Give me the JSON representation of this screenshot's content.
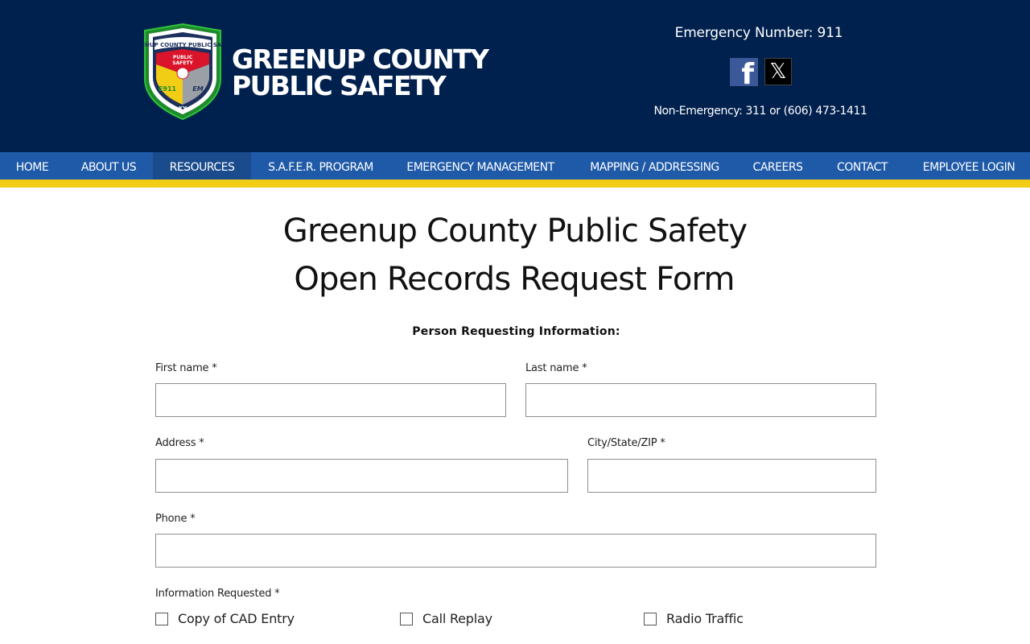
{
  "header": {
    "logo_text": "GREENUP COUNTY PUBLIC SAFETY",
    "logo_sub": "KY",
    "brand_line1": "GREENUP COUNTY",
    "brand_line2": "PUBLIC SAFETY",
    "emergency": "Emergency Number: 911",
    "non_emergency": "Non-Emergency: 311 or (606) 473-1411",
    "social": [
      {
        "name": "facebook-icon",
        "glyph": "f"
      },
      {
        "name": "x-twitter-icon",
        "glyph": "𝕏"
      }
    ]
  },
  "nav": {
    "items": [
      {
        "label": "HOME"
      },
      {
        "label": "ABOUT US"
      },
      {
        "label": "RESOURCES",
        "active": true
      },
      {
        "label": "S.A.F.E.R. PROGRAM"
      },
      {
        "label": "EMERGENCY MANAGEMENT"
      },
      {
        "label": "MAPPING / ADDRESSING"
      },
      {
        "label": "CAREERS"
      },
      {
        "label": "CONTACT"
      },
      {
        "label": "EMPLOYEE LOGIN"
      }
    ]
  },
  "page": {
    "title_line1": "Greenup County Public Safety",
    "title_line2": "Open Records Request Form",
    "section_heading": "Person Requesting Information:"
  },
  "form": {
    "first_name_label": "First name *",
    "first_name_value": "",
    "last_name_label": "Last name *",
    "last_name_value": "",
    "address_label": "Address *",
    "address_value": "",
    "city_label": "City/State/ZIP *",
    "city_value": "",
    "phone_label": "Phone *",
    "phone_value": "",
    "info_label": "Information Requested *",
    "options": [
      {
        "label": "Copy of CAD Entry",
        "checked": false
      },
      {
        "label": "Call Replay",
        "checked": false
      },
      {
        "label": "Radio Traffic",
        "checked": false
      }
    ]
  },
  "colors": {
    "header_bg": "#00204d",
    "nav_bg": "#1f5aa8",
    "nav_active": "#1a4b8d",
    "accent_stripe": "#f2cd16"
  }
}
